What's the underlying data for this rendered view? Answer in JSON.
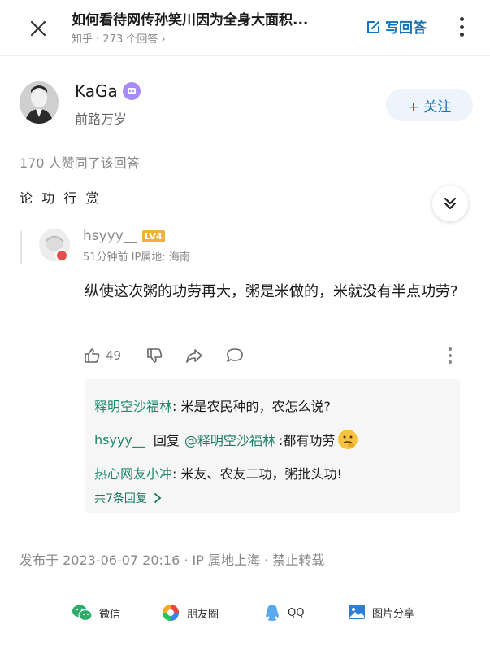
{
  "header": {
    "title": "如何看待网传孙笑川因为全身大面积...",
    "subtitle": "知乎 · 273 个回答 ›",
    "write_answer": "写回答"
  },
  "author": {
    "name": "KaGa",
    "bio": "前路万岁",
    "follow_label": "+ 关注"
  },
  "answer": {
    "votes_text": "170 人赞同了该回答",
    "content": "论 功 行 赏"
  },
  "comment": {
    "user": "hsyyy__",
    "level": "LV4",
    "meta": "51分钟前 IP属地: 海南",
    "body": "纵使这次粥的功劳再大，粥是米做的，米就没有半点功劳?",
    "likes": "49"
  },
  "replies": [
    {
      "name": "释明空沙福林",
      "text": ": 米是农民种的，农怎么说?"
    },
    {
      "name": "hsyyy__",
      "connector": "回复",
      "mention": "@释明空沙福林",
      "text": ":都有功劳"
    },
    {
      "name": "热心网友小冲",
      "text": ": 米友、农友二功，粥批头功!"
    }
  ],
  "more_replies": "共7条回复",
  "publish_info": "发布于 2023-06-07 20:16 · IP 属地上海 · 禁止转载",
  "share": [
    {
      "label": "微信",
      "icon": "wechat-icon",
      "color": "#2aae67"
    },
    {
      "label": "朋友圈",
      "icon": "moments-icon",
      "color": "#f5a623"
    },
    {
      "label": "QQ",
      "icon": "qq-icon",
      "color": "#5aa9f0"
    },
    {
      "label": "图片分享",
      "icon": "image-share-icon",
      "color": "#2f7fd6"
    }
  ],
  "colors": {
    "accent": "#1772b8",
    "reply_name": "#1e7a62"
  }
}
